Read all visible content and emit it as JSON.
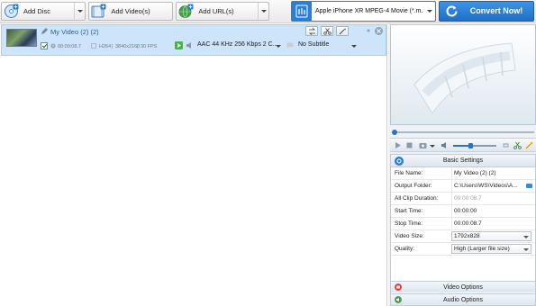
{
  "toolbar": {
    "add_disc_label": "Add Disc",
    "add_video_label": "Add Video(s)",
    "add_url_label": "Add URL(s)",
    "profile_label": "Apple iPhone XR MPEG-4 Movie (*.m...",
    "convert_label": "Convert Now!"
  },
  "file_item": {
    "name": "My Video (2) (2)",
    "duration": "00:00:08.7",
    "codec": "H264",
    "resolution": "3840x2160",
    "fps": "30 FPS",
    "audio_track": "AAC 44 KHz 256 Kbps 2 C...",
    "subtitle": "No Subtitle"
  },
  "player": {
    "seek_position": 0,
    "volume_level": 0.4
  },
  "settings": {
    "title": "Basic Settings",
    "rows": [
      {
        "key": "File Name:",
        "value": "My Video (2) (2)"
      },
      {
        "key": "Output Folder:",
        "value": "C:\\Users\\WS\\Videos\\A..."
      },
      {
        "key": "All Clip Duration:",
        "value": "00:00:08.7"
      },
      {
        "key": "Start Time:",
        "value": "00:00:00"
      },
      {
        "key": "Stop Time:",
        "value": "00:00:08.7"
      },
      {
        "key": "Video Size:",
        "value": "1792x828"
      },
      {
        "key": "Quality:",
        "value": "High (Larger file size)"
      }
    ]
  },
  "sections": {
    "video_options": "Video Options",
    "audio_options": "Audio Options"
  },
  "colors": {
    "accent": "#2a7fd4",
    "selected_row": "#cde4fa",
    "convert_button": "#2a7fd4"
  }
}
